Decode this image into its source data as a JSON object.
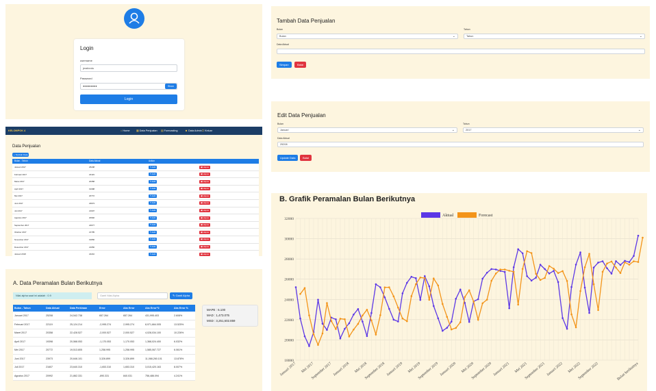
{
  "login": {
    "title": "Login",
    "username_label": "username",
    "username_value": "jeraforotu",
    "password_label": "Password",
    "password_value": "●●●●●●●●●",
    "show_label": "Show",
    "submit_label": "Login"
  },
  "tambah": {
    "title": "Tambah Data Penjualan",
    "bulan_label": "Bulan",
    "bulan_placeholder": "Bulan",
    "tahun_label": "Tahun",
    "tahun_placeholder": "Tahun",
    "aktual_label": "Data Aktual",
    "simpan": "Simpan",
    "batal": "Batal"
  },
  "edit": {
    "title": "Edit Data Penjualan",
    "bulan_label": "Bulan",
    "bulan_value": "Januari",
    "tahun_label": "Tahun",
    "tahun_value": "2017",
    "aktual_label": "Data Aktual",
    "aktual_value": "25208",
    "update": "Update Data",
    "batal": "Batal"
  },
  "navbar": {
    "brand": "KELOMPOK 4",
    "items": [
      "Home",
      "Data Penjualan",
      "Forecasting",
      "Data Admin",
      "Keluar"
    ]
  },
  "penjualan": {
    "title": "Data Penjualan",
    "add_label": "Tambah Data",
    "columns": [
      "Bulan - Tahun",
      "Data Aktual",
      "Action"
    ],
    "edit_label": "Edit",
    "delete_label": "Hapus",
    "rows": [
      [
        "Januari 2017",
        "25208"
      ],
      [
        "Februari 2017",
        "22119"
      ],
      [
        "Maret 2017",
        "20358"
      ],
      [
        "April 2017",
        "19398"
      ],
      [
        "Mei 2017",
        "20772"
      ],
      [
        "Juni 2017",
        "23973"
      ],
      [
        "Juli 2017",
        "21607"
      ],
      [
        "Agustus 2017",
        "20992"
      ],
      [
        "September 2017",
        "22677"
      ],
      [
        "Oktober 2017",
        "21795"
      ],
      [
        "November 2017",
        "19650"
      ],
      [
        "Desember 2017",
        "21650"
      ],
      [
        "Januari 2018",
        "22210"
      ]
    ]
  },
  "peramalan": {
    "title": "A. Data Peramalan Bulan Berikutnya",
    "alpha_text": "Nilai alpha saat ini adalah : 0.9",
    "alpha_placeholder": "Ganti Nilai Alpha",
    "alpha_button": "Ganti Alpha",
    "columns": [
      "Bulan - Tahun",
      "Data Aktual",
      "Data Perkiraan",
      "Error",
      "Abs Error",
      "Abs Error^2",
      "Abs Error %"
    ],
    "rows": [
      [
        "Januari 2017",
        "25208",
        "24,542.738",
        "657.264",
        "657.264",
        "431,995.403",
        "2.608%"
      ],
      [
        "Februari 2017",
        "22119",
        "25,124.214",
        "-2,995.274",
        "2,995.274",
        "8,971,664.005",
        "13.525%"
      ],
      [
        "Maret 2017",
        "20358",
        "22,428.527",
        "-2,000.527",
        "2,000.527",
        "4,028,034.100",
        "10.226%"
      ],
      [
        "April 2017",
        "19398",
        "20,568.053",
        "-1,170.053",
        "1,170.053",
        "1,368,024.400",
        "6.032%"
      ],
      [
        "Mei 2017",
        "20772",
        "19,513.805",
        "1,258.995",
        "1,258.995",
        "1,585,067.727",
        "6.061%"
      ],
      [
        "Juni 2017",
        "23973",
        "20,646.101",
        "3,326.899",
        "3,326.899",
        "11,068,260.101",
        "13.878%"
      ],
      [
        "Juli 2017",
        "21607",
        "23,640.310",
        "-1,653.310",
        "1,653.310",
        "3,015,420.163",
        "8.007%"
      ],
      [
        "Agustus 2017",
        "20992",
        "21,862.331",
        "-890.331",
        "840.031",
        "756,486.094",
        "4.241%"
      ]
    ],
    "mape": "MAPE : 6.100",
    "mad": "MAD : 1,473.075",
    "msd": "MSD : 3,251,602.859"
  },
  "grafik": {
    "title": "B. Grafik Peramalan Bulan Berikutnya",
    "colors": {
      "aktual": "#5b37e6",
      "forecast": "#f39419"
    }
  },
  "chart_data": {
    "type": "line",
    "title": "B. Grafik Peramalan Bulan Berikutnya",
    "ylim": [
      18000,
      32000
    ],
    "yticks": [
      18000,
      20000,
      22000,
      24000,
      26000,
      28000,
      30000,
      32000
    ],
    "xtick_labels": [
      "Januari 2017",
      "Mei 2017",
      "September 2017",
      "Januari 2018",
      "Mei 2018",
      "September 2018",
      "Januari 2019",
      "Mei 2019",
      "September 2019",
      "Januari 2020",
      "Mei 2020",
      "September 2020",
      "Januari 2021",
      "Mei 2021",
      "September 2021",
      "Januari 2022",
      "Mei 2022",
      "September 2022",
      "Bulan berikutnya"
    ],
    "legend": "top-center",
    "grid": true,
    "series": [
      {
        "name": "Aktual",
        "values": [
          25208,
          22119,
          20358,
          19398,
          20772,
          23973,
          21607,
          20992,
          22210,
          22040,
          20150,
          21100,
          21650,
          22510,
          23050,
          21810,
          20380,
          22660,
          25500,
          25200,
          24200,
          23070,
          22000,
          21820,
          24600,
          25640,
          26240,
          26100,
          23950,
          26300,
          25300,
          23350,
          22140,
          20900,
          21200,
          21810,
          24070,
          24980,
          23660,
          21780,
          23800,
          24020,
          26050,
          26640,
          27000,
          26960,
          26820,
          26720,
          23130,
          27180,
          28960,
          28560,
          26300,
          25860,
          26150,
          27430,
          27000,
          26560,
          26820,
          25720,
          22160,
          21100,
          25230,
          27440,
          28650,
          25170,
          22670,
          27150,
          27640,
          27770,
          27080,
          26550,
          27780,
          27410,
          27810,
          27690,
          28300,
          30300
        ]
      },
      {
        "name": "Forecast",
        "values": [
          24542,
          25124,
          22428,
          20568,
          19513,
          20646,
          23640,
          21862,
          21079,
          22096,
          22046,
          20339,
          21024,
          21588,
          22418,
          22987,
          21928,
          20535,
          22447,
          25195,
          25199,
          24300,
          23193,
          22119,
          21850,
          24325,
          25508,
          26167,
          26107,
          23966,
          26067,
          25377,
          23553,
          22281,
          21038,
          21184,
          21747,
          24238,
          24906,
          23785,
          22000,
          23620,
          23980,
          25843,
          26560,
          26956,
          26960,
          26834,
          26731,
          23490,
          27010,
          28765,
          28581,
          26528,
          25927,
          26128,
          27300,
          27030,
          26607,
          26799,
          25827,
          22527,
          21243,
          24831,
          27179,
          28503,
          25503,
          22953,
          26730,
          27549,
          27748,
          27147,
          26610,
          27663,
          27435,
          27772,
          27698,
          30100
        ]
      }
    ]
  }
}
